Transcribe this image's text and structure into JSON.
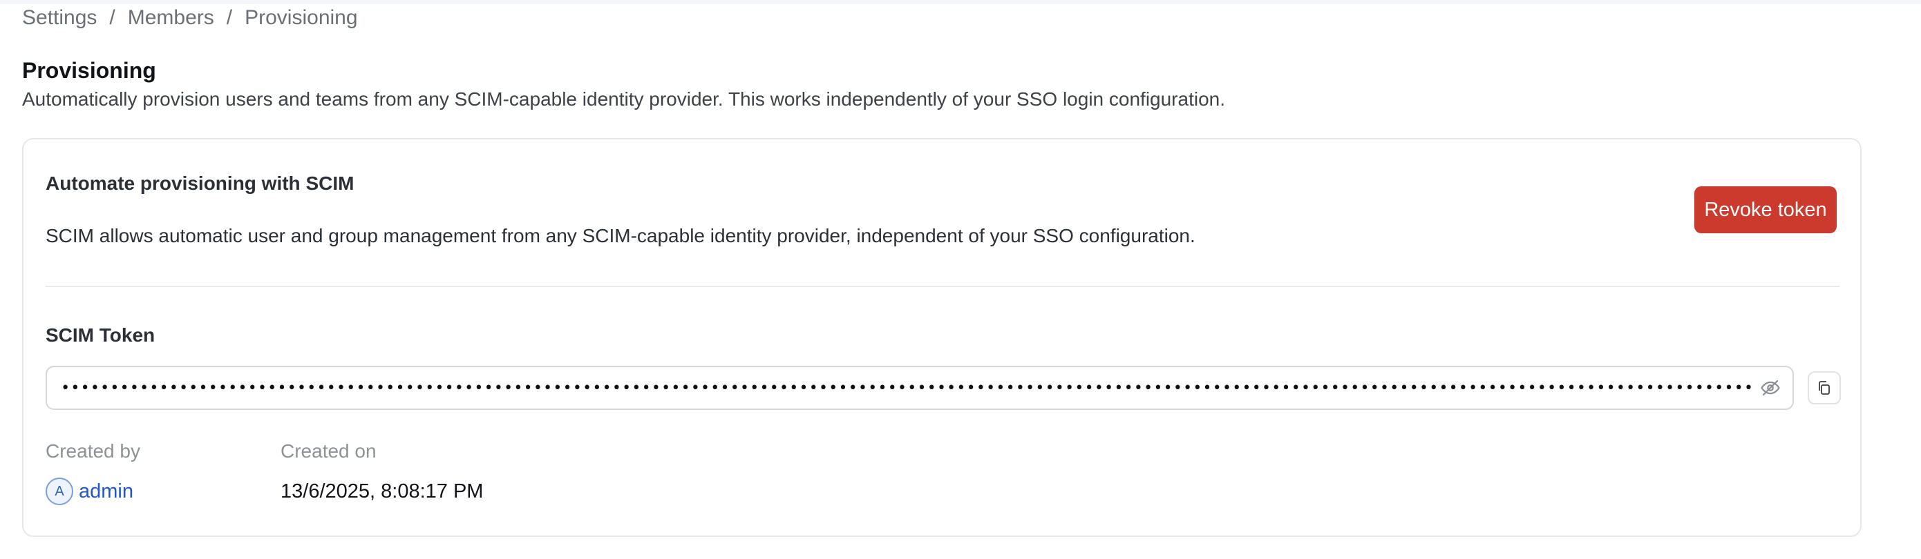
{
  "breadcrumb": {
    "items": [
      "Settings",
      "Members",
      "Provisioning"
    ],
    "separator": "/"
  },
  "page": {
    "title": "Provisioning",
    "description": "Automatically provision users and teams from any SCIM-capable identity provider. This works independently of your SSO login configuration."
  },
  "card": {
    "title": "Automate provisioning with SCIM",
    "description": "SCIM allows automatic user and group management from any SCIM-capable identity provider, independent of your SSO configuration.",
    "revoke_label": "Revoke token",
    "token_label": "SCIM Token",
    "token_masked": "••••••••••••••••••••••••••••••••••••••••••••••••••••••••••••••••••••••••••••••••••••••••••••••••••••••••••••••••••••••••••••••••••••••••••••••••••••••••••••••••••••••••••••••••••",
    "created_by_label": "Created by",
    "created_on_label": "Created on",
    "creator_initial": "A",
    "creator_name": "admin",
    "created_on": "13/6/2025, 8:08:17 PM"
  },
  "icons": {
    "visibility": "eye-off-icon",
    "copy": "copy-icon"
  },
  "colors": {
    "danger": "#cc3a2d",
    "link": "#2056c8"
  }
}
